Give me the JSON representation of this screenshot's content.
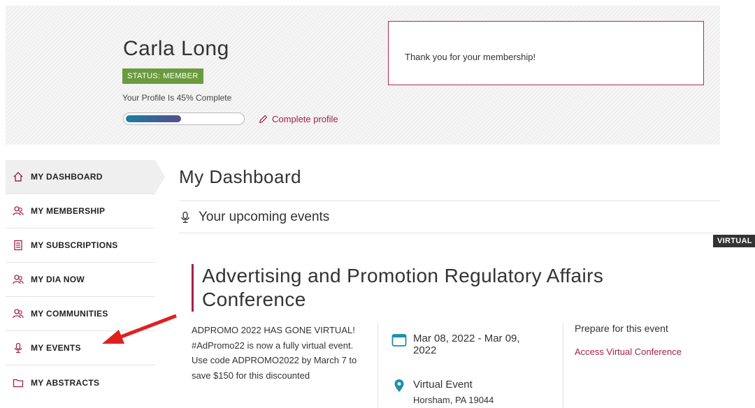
{
  "profile": {
    "name": "Carla Long",
    "status": "STATUS: MEMBER",
    "completion_text": "Your Profile Is 45% Complete",
    "completion_percent": 45,
    "complete_link": "Complete profile",
    "thanks_message": "Thank you for your membership!"
  },
  "sidebar": {
    "items": [
      {
        "label": "MY DASHBOARD",
        "icon": "home-icon",
        "active": true
      },
      {
        "label": "MY MEMBERSHIP",
        "icon": "members-icon"
      },
      {
        "label": "MY SUBSCRIPTIONS",
        "icon": "document-icon"
      },
      {
        "label": "MY DIA NOW",
        "icon": "members-icon"
      },
      {
        "label": "MY COMMUNITIES",
        "icon": "members-icon"
      },
      {
        "label": "MY EVENTS",
        "icon": "microphone-icon"
      },
      {
        "label": "MY ABSTRACTS",
        "icon": "folder-icon"
      }
    ]
  },
  "main": {
    "title": "My Dashboard",
    "section_heading": "Your upcoming events",
    "badge": "VIRTUAL",
    "event": {
      "title": "Advertising and Promotion Regulatory Affairs Conference",
      "description": "ADPROMO 2022 HAS GONE VIRTUAL! #AdPromo22 is now a fully virtual event. Use code ADPROMO2022 by March 7 to save $150 for this discounted",
      "date": "Mar 08, 2022 - Mar 09, 2022",
      "location_name": "Virtual Event",
      "location_address": "Horsham, PA 19044",
      "prepare_heading": "Prepare for this event",
      "access_link": "Access Virtual Conference"
    }
  },
  "colors": {
    "accent": "#a3204f",
    "status_green": "#6a9b3e",
    "teal_icon": "#1b8fb0"
  }
}
